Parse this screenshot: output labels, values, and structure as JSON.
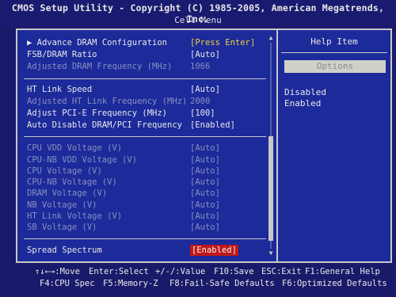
{
  "header": {
    "title": "CMOS Setup Utility - Copyright (C) 1985-2005, American Megatrends, Inc.",
    "subtitle": "Cell Menu"
  },
  "settings": [
    {
      "label": "▶ Advance DRAM Configuration",
      "value": "[Press Enter]",
      "state": "submenu"
    },
    {
      "label": "FSB/DRAM Ratio",
      "value": "[Auto]",
      "state": "normal"
    },
    {
      "label": "Adjusted DRAM Frequency (MHz)",
      "value": "1066",
      "state": "readonly"
    },
    {
      "label": "HT Link Speed",
      "value": "[Auto]",
      "state": "normal"
    },
    {
      "label": "Adjusted HT Link Frequency (MHz)",
      "value": "2000",
      "state": "readonly"
    },
    {
      "label": "Adjust PCI-E Frequency (MHz)",
      "value": "[100]",
      "state": "normal"
    },
    {
      "label": "Auto Disable DRAM/PCI Frequency",
      "value": "[Enabled]",
      "state": "normal"
    },
    {
      "label": "CPU VDD Voltage (V)",
      "value": "[Auto]",
      "state": "readonly"
    },
    {
      "label": "CPU-NB VDD Voltage (V)",
      "value": "[Auto]",
      "state": "readonly"
    },
    {
      "label": "CPU Voltage (V)",
      "value": "[Auto]",
      "state": "readonly"
    },
    {
      "label": "CPU-NB Voltage (V)",
      "value": "[Auto]",
      "state": "readonly"
    },
    {
      "label": "DRAM Voltage (V)",
      "value": "[Auto]",
      "state": "readonly"
    },
    {
      "label": "NB Voltage (V)",
      "value": "[Auto]",
      "state": "readonly"
    },
    {
      "label": "HT Link Voltage (V)",
      "value": "[Auto]",
      "state": "readonly"
    },
    {
      "label": "SB Voltage (V)",
      "value": "[Auto]",
      "state": "readonly"
    },
    {
      "label": "Spread Spectrum",
      "value": "[Enabled]",
      "state": "selected"
    }
  ],
  "help": {
    "title": "Help Item",
    "options_label": "Options",
    "options": [
      "Disabled",
      "Enabled"
    ]
  },
  "scroll_icons": {
    "up": "triangle-up-icon",
    "down": "triangle-down-icon"
  },
  "footer": {
    "row1": [
      "↑↓←→:Move",
      "Enter:Select",
      "+/-/:Value",
      "F10:Save",
      "ESC:Exit",
      "F1:General Help"
    ],
    "row2": [
      "F4:CPU Spec",
      "F5:Memory-Z",
      "F8:Fail-Safe Defaults",
      "F6:Optimized Defaults"
    ]
  },
  "colors": {
    "background": "#1a1a6a",
    "panel": "#1c2a9a",
    "highlight_value": "#f0d040",
    "selected_bg": "#c01818",
    "readonly_text": "#8890c0"
  }
}
